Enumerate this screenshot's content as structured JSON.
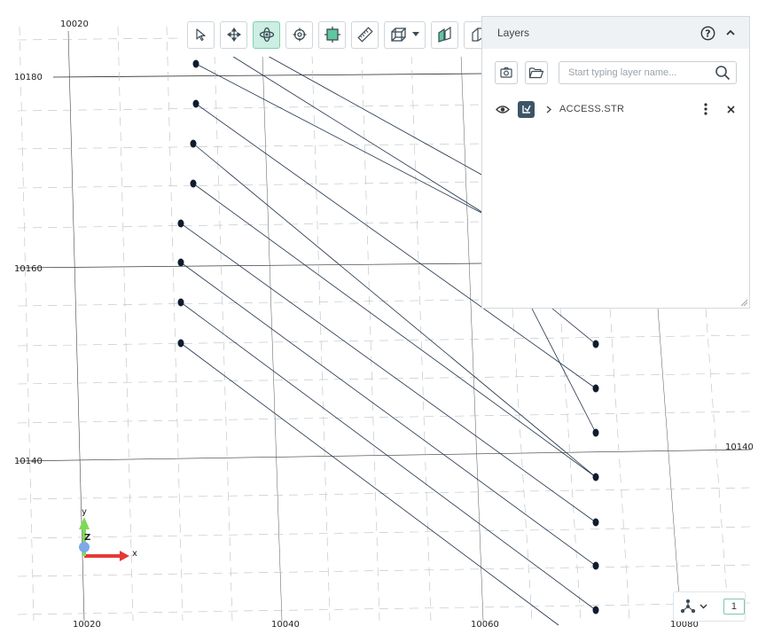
{
  "viewport": {
    "axis_labels": [
      {
        "id": "x-10020-top",
        "text": "10020"
      },
      {
        "id": "y-10180",
        "text": "10180"
      },
      {
        "id": "y-10160",
        "text": "10160"
      },
      {
        "id": "y-10140-left",
        "text": "10140"
      },
      {
        "id": "y-10140-right",
        "text": "10140"
      },
      {
        "id": "x-10020-bottom",
        "text": "10020"
      },
      {
        "id": "x-10040-bottom",
        "text": "10040"
      },
      {
        "id": "x-10060-bottom",
        "text": "10060"
      },
      {
        "id": "x-10080-bottom",
        "text": "10080"
      }
    ],
    "gizmo": {
      "y_label": "y",
      "z_label": "Z",
      "x_label": "x",
      "x_color": "#e53935",
      "y_color": "#7ed957",
      "z_color": "#7fa8e8"
    },
    "strings": {
      "line_color": "#1f3147",
      "point_color": "#0f1c2e"
    }
  },
  "toolbar": {
    "buttons": [
      {
        "name": "select",
        "icon": "cursor-icon",
        "active": false
      },
      {
        "name": "pan",
        "icon": "move-arrows-icon",
        "active": false
      },
      {
        "name": "orbit",
        "icon": "orbit-icon",
        "active": true
      },
      {
        "name": "target",
        "icon": "crosshair-icon",
        "active": false
      },
      {
        "name": "fit",
        "icon": "fit-frame-icon",
        "active": false
      },
      {
        "name": "measure",
        "icon": "ruler-icon",
        "active": false
      },
      {
        "name": "view-cube",
        "icon": "cube-icon",
        "active": false
      },
      {
        "name": "section",
        "icon": "section-planes-icon",
        "active": false
      },
      {
        "name": "clip",
        "icon": "clip-plane-icon",
        "active": false
      }
    ]
  },
  "layers": {
    "title": "Layers",
    "search_placeholder": "Start typing layer name...",
    "items": [
      {
        "name": "ACCESS.STR",
        "visible": true
      }
    ]
  },
  "view_widget": {
    "count": "1"
  },
  "colors": {
    "accent": "#cdeee2",
    "accent_border": "#7fd0b0",
    "panel_header": "#eef2f4",
    "badge": "#3c5566"
  }
}
